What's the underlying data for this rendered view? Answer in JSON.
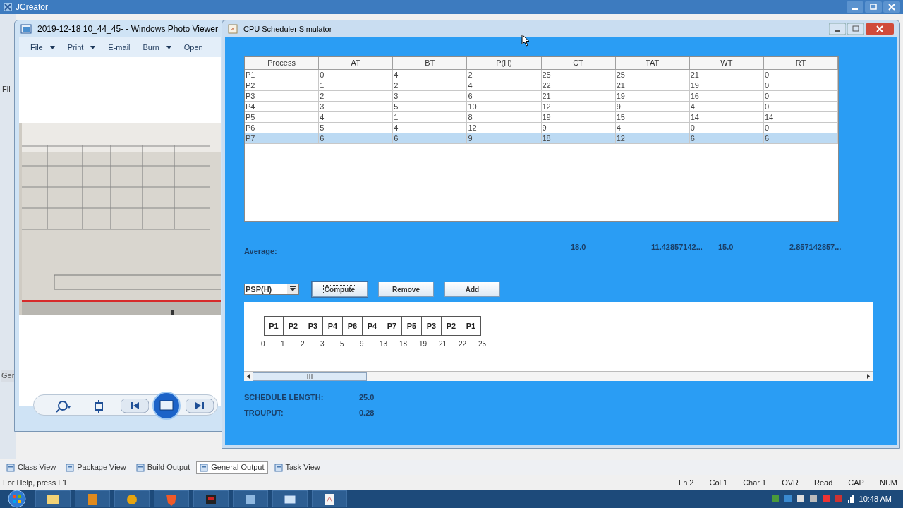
{
  "ide": {
    "title": "JCreator",
    "side_labels": [
      "Fil",
      "Ger"
    ],
    "bottom_tabs": [
      {
        "label": "Class View",
        "selected": false
      },
      {
        "label": "Package View",
        "selected": false
      },
      {
        "label": "Build Output",
        "selected": false
      },
      {
        "label": "General Output",
        "selected": true
      },
      {
        "label": "Task View",
        "selected": false
      }
    ],
    "status_bar": {
      "help": "For Help, press F1",
      "items": [
        "Ln 2",
        "Col 1",
        "Char 1",
        "OVR",
        "Read",
        "CAP",
        "NUM"
      ]
    }
  },
  "photo_viewer": {
    "title": "2019-12-18 10_44_45- - Windows Photo Viewer",
    "menu": [
      {
        "label": "File",
        "dropdown": true
      },
      {
        "label": "Print",
        "dropdown": true
      },
      {
        "label": "E-mail",
        "dropdown": false
      },
      {
        "label": "Burn",
        "dropdown": true
      },
      {
        "label": "Open",
        "dropdown": false
      }
    ]
  },
  "simulator": {
    "title": "CPU Scheduler Simulator",
    "table": {
      "columns": [
        "Process",
        "AT",
        "BT",
        "P(H)",
        "CT",
        "TAT",
        "WT",
        "RT"
      ],
      "rows": [
        {
          "cells": [
            "P1",
            "0",
            "4",
            "2",
            "25",
            "25",
            "21",
            "0"
          ],
          "selected": false
        },
        {
          "cells": [
            "P2",
            "1",
            "2",
            "4",
            "22",
            "21",
            "19",
            "0"
          ],
          "selected": false
        },
        {
          "cells": [
            "P3",
            "2",
            "3",
            "6",
            "21",
            "19",
            "16",
            "0"
          ],
          "selected": false
        },
        {
          "cells": [
            "P4",
            "3",
            "5",
            "10",
            "12",
            "9",
            "4",
            "0"
          ],
          "selected": false
        },
        {
          "cells": [
            "P5",
            "4",
            "1",
            "8",
            "19",
            "15",
            "14",
            "14"
          ],
          "selected": false
        },
        {
          "cells": [
            "P6",
            "5",
            "4",
            "12",
            "9",
            "4",
            "0",
            "0"
          ],
          "selected": false
        },
        {
          "cells": [
            "P7",
            "6",
            "6",
            "9",
            "18",
            "12",
            "6",
            "6"
          ],
          "selected": true
        }
      ]
    },
    "average": {
      "label": "Average:",
      "values": [
        "18.0",
        "11.42857142...",
        "15.0",
        "2.857142857..."
      ]
    },
    "algorithm": "PSP(H)",
    "buttons": [
      {
        "label": "Compute",
        "focused": true
      },
      {
        "label": "Remove",
        "focused": false
      },
      {
        "label": "Add",
        "focused": false
      }
    ],
    "gantt": {
      "blocks": [
        "P1",
        "P2",
        "P3",
        "P4",
        "P6",
        "P4",
        "P7",
        "P5",
        "P3",
        "P2",
        "P1"
      ],
      "times": [
        "0",
        "1",
        "2",
        "3",
        "5",
        "9",
        "13",
        "18",
        "19",
        "21",
        "22",
        "25"
      ]
    },
    "schedule_length": {
      "label": "SCHEDULE LENGTH:",
      "value": "25.0"
    },
    "throughput": {
      "label": "TROUPUT:",
      "value": "0.28"
    }
  },
  "taskbar": {
    "clock": "10:48 AM"
  }
}
